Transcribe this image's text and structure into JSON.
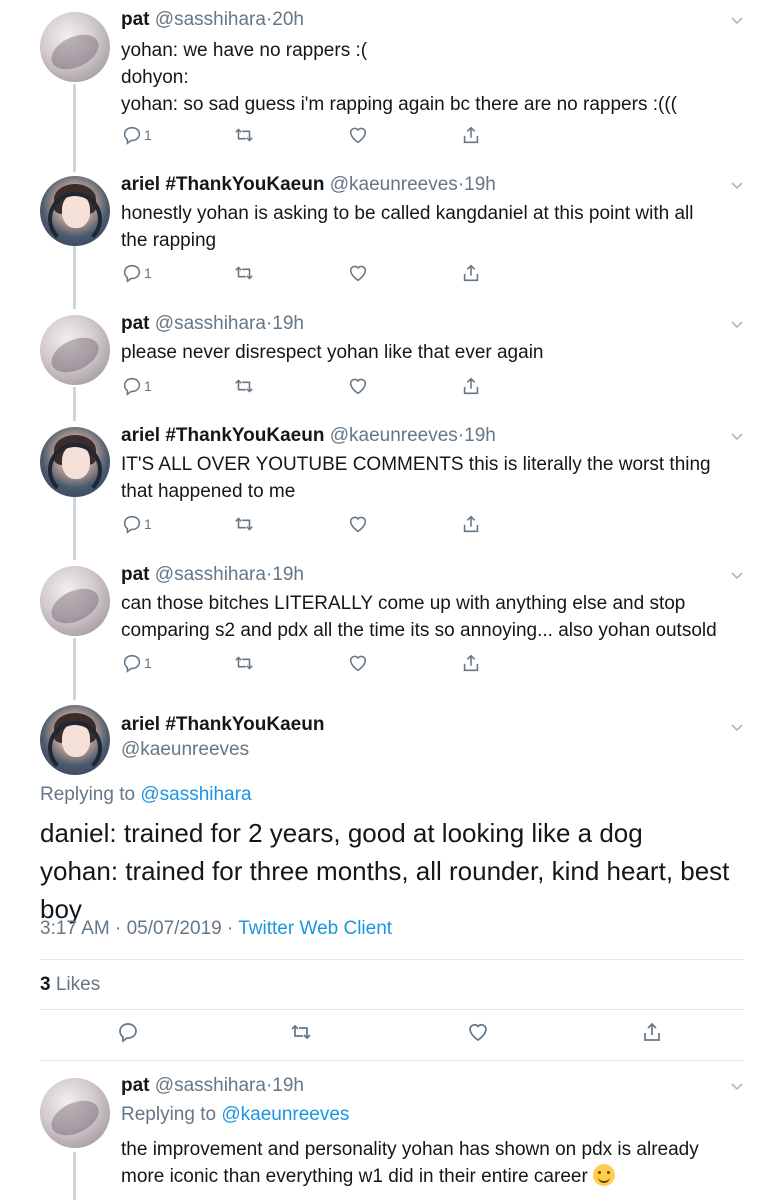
{
  "tweets": [
    {
      "name": "pat",
      "handle": "@sasshihara",
      "time": "20h",
      "lines": [
        "yohan: we have no rappers :(",
        "dohyon:",
        "yohan: so sad guess i'm rapping again bc there are no rappers :((("
      ],
      "reply_count": "1"
    },
    {
      "name": "ariel #ThankYouKaeun",
      "handle": "@kaeunreeves",
      "time": "19h",
      "lines": [
        "honestly yohan is asking to be called kangdaniel at this point with all",
        "the rapping"
      ],
      "reply_count": "1"
    },
    {
      "name": "pat",
      "handle": "@sasshihara",
      "time": "19h",
      "lines": [
        "please never disrespect yohan like that ever again"
      ],
      "reply_count": "1"
    },
    {
      "name": "ariel #ThankYouKaeun",
      "handle": "@kaeunreeves",
      "time": "19h",
      "lines": [
        "IT'S ALL OVER YOUTUBE COMMENTS this is literally the worst thing",
        "that happened to me"
      ],
      "reply_count": "1"
    },
    {
      "name": "pat",
      "handle": "@sasshihara",
      "time": "19h",
      "lines": [
        "can those bitches LITERALLY come up with anything else and stop",
        "comparing s2 and pdx all the time its so annoying... also yohan outsold"
      ],
      "reply_count": "1"
    }
  ],
  "focus": {
    "name": "ariel #ThankYouKaeun",
    "handle": "@kaeunreeves",
    "replying_prefix": "Replying to ",
    "replying_to": "@sasshihara",
    "lines": [
      "daniel: trained for 2 years, good at looking like a dog",
      "yohan: trained for three months, all rounder, kind heart, best boy"
    ],
    "time": "3:17 AM",
    "date": "05/07/2019",
    "client": "Twitter Web Client",
    "likes_count": "3",
    "likes_label": "Likes"
  },
  "last": {
    "name": "pat",
    "handle": "@sasshihara",
    "time": "19h",
    "replying_prefix": "Replying to ",
    "replying_to": "@kaeunreeves",
    "lines": [
      "the improvement and personality yohan has shown on pdx is already",
      "more iconic than everything w1 did in their entire career"
    ]
  },
  "separator_dot": "·",
  "icons": [
    "reply-icon",
    "retweet-icon",
    "like-icon",
    "share-icon",
    "chevron-down-icon",
    "smiling-face-emoji"
  ]
}
